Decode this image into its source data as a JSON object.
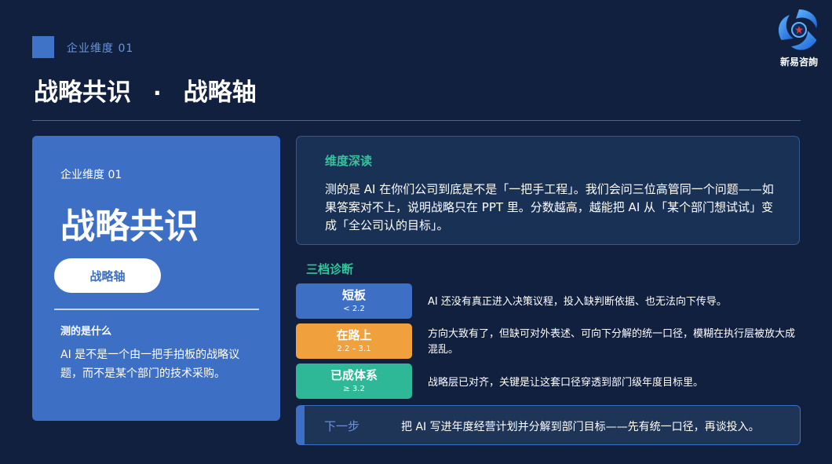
{
  "header": {
    "eyebrow": "企业维度 01",
    "title_main": "战略共识",
    "title_dot": "·",
    "title_sub": "战略轴"
  },
  "logo": {
    "name": "新易咨詢"
  },
  "left_card": {
    "eyebrow": "企业维度 01",
    "title": "战略共识",
    "pill_label": "战略轴",
    "subheading": "测的是什么",
    "body": "AI 是不是一个由一把手拍板的战略议题，而不是某个部门的技术采购。"
  },
  "deep_read": {
    "title": "维度深读",
    "body": "测的是 AI 在你们公司到底是不是「一把手工程」。我们会问三位高管同一个问题——如果答案对不上，说明战略只在 PPT 里。分数越高，越能把 AI 从「某个部门想试试」变成「全公司认的目标」。"
  },
  "diagnosis": {
    "title": "三档诊断",
    "tiers": [
      {
        "name": "短板",
        "range": "< 2.2",
        "color": "#3d6fc4",
        "desc": "AI 还没有真正进入决策议程，投入缺判断依据、也无法向下传导。"
      },
      {
        "name": "在路上",
        "range": "2.2 – 3.1",
        "color": "#f0a03c",
        "desc": "方向大致有了，但缺可对外表述、可向下分解的统一口径，模糊在执行层被放大成混乱。"
      },
      {
        "name": "已成体系",
        "range": "≥ 3.2",
        "color": "#2eb897",
        "desc": "战略层已对齐，关键是让这套口径穿透到部门级年度目标里。"
      }
    ]
  },
  "next_step": {
    "label": "下一步",
    "text": "把 AI 写进年度经营计划并分解到部门目标——先有统一口径，再谈投入。"
  },
  "colors": {
    "background": "#11203f",
    "accent_blue": "#3d6fc4",
    "accent_green": "#35c49a",
    "accent_orange": "#f0a03c"
  }
}
